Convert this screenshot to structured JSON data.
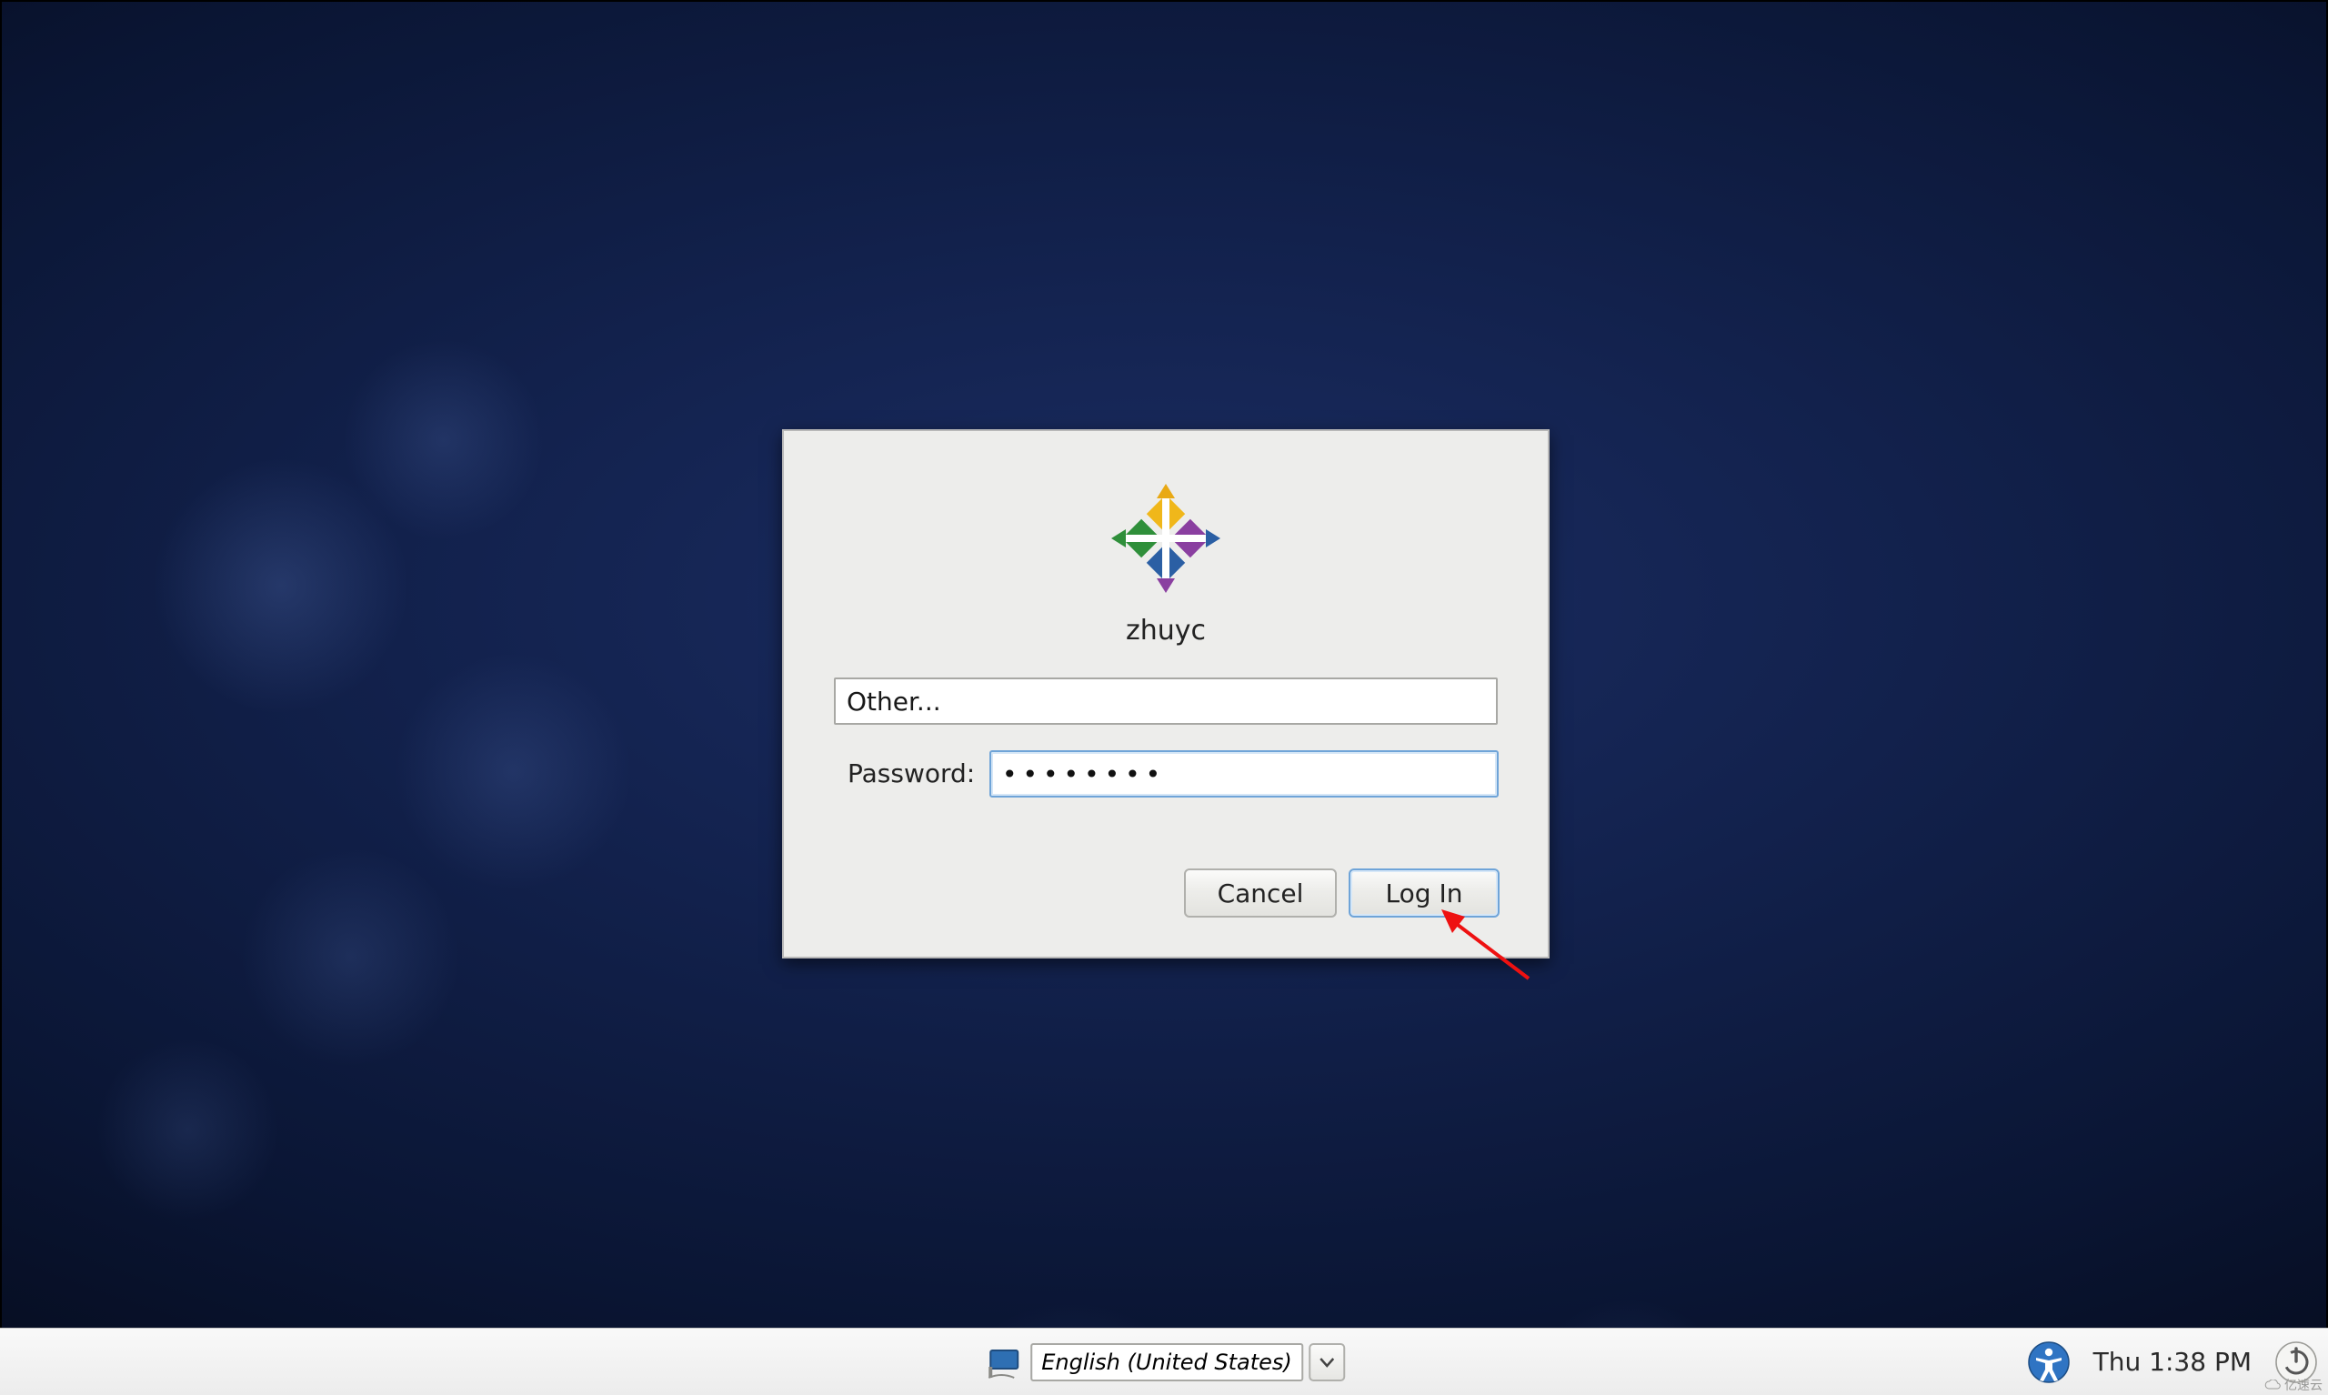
{
  "login": {
    "username_display": "zhuyc",
    "other_value": "Other...",
    "password_label": "Password:",
    "password_value": "••••••••",
    "cancel_label": "Cancel",
    "login_label": "Log In"
  },
  "panel": {
    "language": "English (United States)",
    "clock": "Thu  1:38 PM"
  },
  "watermark": "亿速云"
}
